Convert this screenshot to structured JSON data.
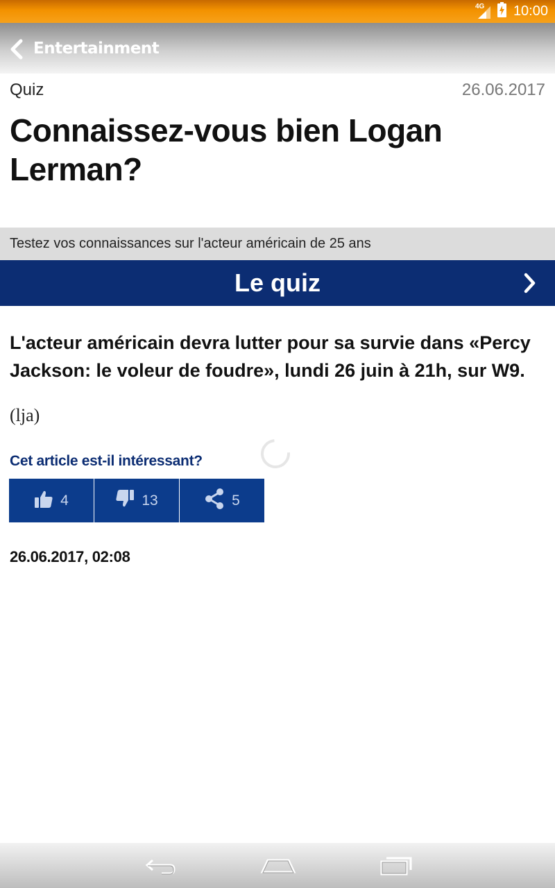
{
  "status_bar": {
    "network": "4G",
    "time": "10:00"
  },
  "app_bar": {
    "title": "Entertainment"
  },
  "article": {
    "kicker": "Quiz",
    "date": "26.06.2017",
    "headline": "Connaissez-vous bien Logan Lerman?",
    "lead": "Testez vos connaissances sur l'acteur américain de 25 ans",
    "quiz_button": "Le quiz",
    "body": "L'acteur américain devra lutter pour sa survie dans «Percy Jackson: le voleur de foudre», lundi 26 juin à 21h, sur W9.",
    "author": "(lja)",
    "feedback_question": "Cet article est-il intéressant?",
    "likes": "4",
    "dislikes": "13",
    "shares": "5",
    "timestamp": "26.06.2017, 02:08"
  },
  "colors": {
    "status_bar": "#f39200",
    "accent_dark_blue": "#0c2d73",
    "vote_blue": "#0c3c8c"
  },
  "icons": [
    "signal-4g-icon",
    "battery-charging-icon",
    "chevron-left-icon",
    "chevron-right-icon",
    "thumbs-up-icon",
    "thumbs-down-icon",
    "share-icon",
    "nav-back-icon",
    "nav-home-icon",
    "nav-recents-icon"
  ]
}
